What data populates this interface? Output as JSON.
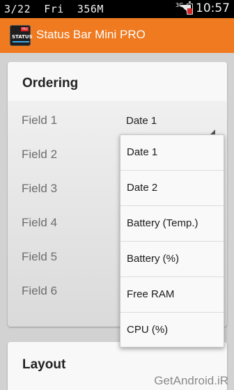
{
  "status_bar": {
    "date": "3/22",
    "day": "Fri",
    "memory": "356M",
    "network": "3G",
    "time": "10:57",
    "battery_color": "#d32626"
  },
  "action_bar": {
    "title": "Status Bar Mini PRO",
    "icon_text": "STATUS",
    "icon_badge": "PRO",
    "color": "#f07a20"
  },
  "ordering": {
    "title": "Ordering",
    "fields": [
      {
        "label": "Field 1",
        "value": "Date 1"
      },
      {
        "label": "Field 2"
      },
      {
        "label": "Field 3"
      },
      {
        "label": "Field 4"
      },
      {
        "label": "Field 5"
      },
      {
        "label": "Field 6"
      }
    ]
  },
  "dropdown": {
    "options": [
      "Date 1",
      "Date 2",
      "Battery (Temp.)",
      "Battery (%)",
      "Free RAM",
      "CPU (%)"
    ]
  },
  "layout": {
    "title": "Layout"
  },
  "watermark": "GetAndroid.iR"
}
